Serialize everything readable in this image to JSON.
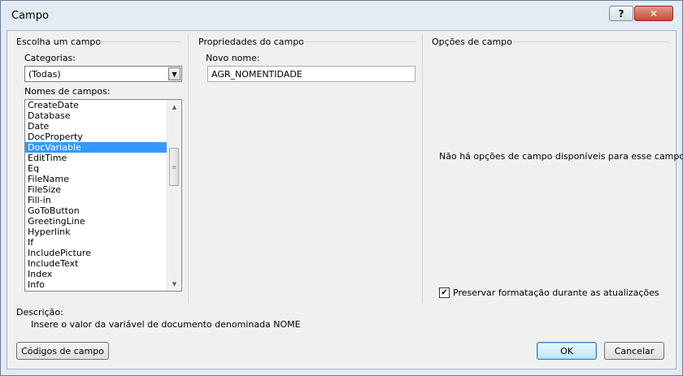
{
  "window": {
    "title": "Campo",
    "help_label": "?",
    "close_label": "✕"
  },
  "left_panel": {
    "group_title": "Escolha um campo",
    "categories_label": "Categorias:",
    "categories_value": "(Todas)",
    "field_names_label": "Nomes de campos:",
    "field_names": [
      "CreateDate",
      "Database",
      "Date",
      "DocProperty",
      "DocVariable",
      "EditTime",
      "Eq",
      "FileName",
      "FileSize",
      "Fill-in",
      "GoToButton",
      "GreetingLine",
      "Hyperlink",
      "If",
      "IncludePicture",
      "IncludeText",
      "Index",
      "Info"
    ],
    "selected_field": "DocVariable"
  },
  "middle_panel": {
    "group_title": "Propriedades do campo",
    "new_name_label": "Novo nome:",
    "new_name_value": "AGR_NOMENTIDADE"
  },
  "right_panel": {
    "group_title": "Opções de campo",
    "no_options_text": "Não há opções de campo disponíveis para esse campo",
    "preserve_format_label": "Preservar formatação durante as atualizações",
    "preserve_format_checked": true
  },
  "description": {
    "label": "Descrição:",
    "text": "Insere o valor da variável de documento denominada NOME"
  },
  "buttons": {
    "field_codes": "Códigos de campo",
    "ok": "OK",
    "cancel": "Cancelar"
  }
}
